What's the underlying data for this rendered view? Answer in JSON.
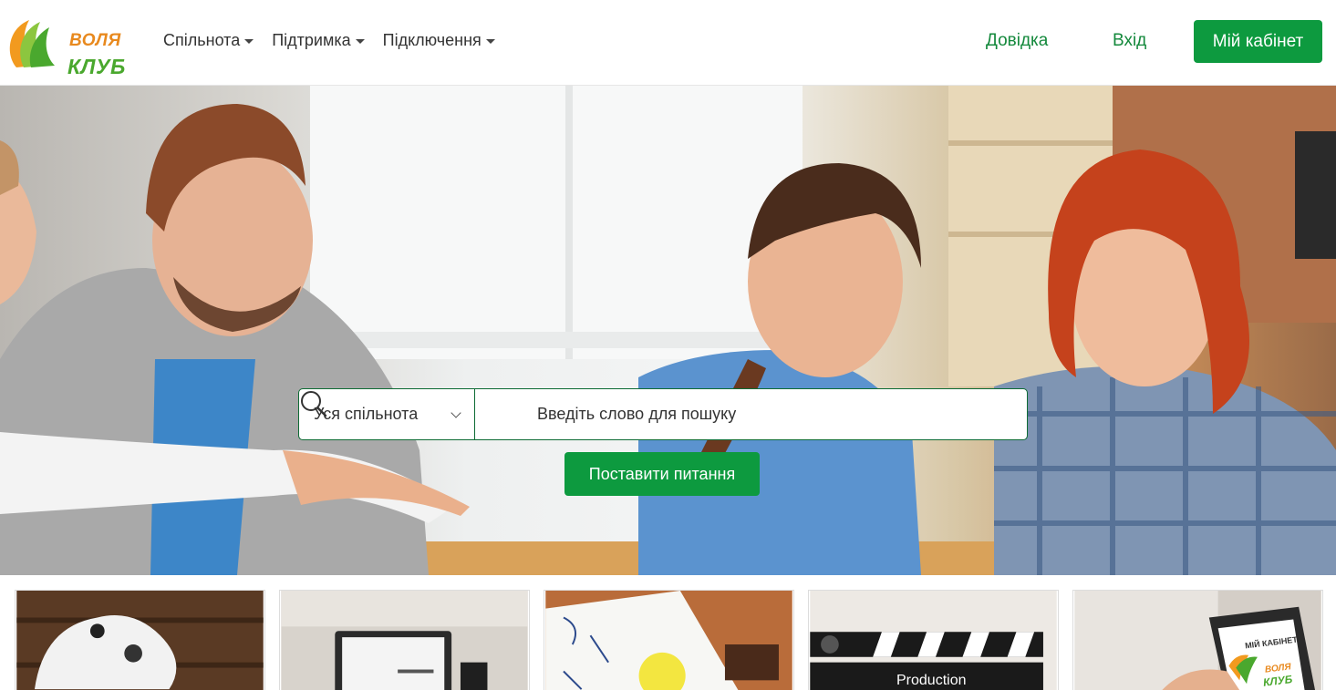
{
  "logo": {
    "line1": "ВОЛЯ",
    "line2": "КЛУБ"
  },
  "nav": {
    "items": [
      {
        "label": "Спільнота"
      },
      {
        "label": "Підтримка"
      },
      {
        "label": "Підключення"
      }
    ]
  },
  "header": {
    "help_label": "Довідка",
    "login_label": "Вхід",
    "cabinet_label": "Мій кабінет"
  },
  "search": {
    "scope_selected": "Уся спільнота",
    "placeholder": "Введіть слово для пошуку"
  },
  "hero": {
    "ask_label": "Поставити питання"
  },
  "cards": [
    {
      "name": "games"
    },
    {
      "name": "laptop"
    },
    {
      "name": "ideas"
    },
    {
      "name": "production",
      "caption": "Production"
    },
    {
      "name": "my-cabinet",
      "caption": "МІЙ КАБІНЕТ",
      "logo_line1": "ВОЛЯ",
      "logo_line2": "КЛУБ"
    }
  ],
  "colors": {
    "brand_green": "#0d9a3f",
    "link_green": "#14893c",
    "logo_orange": "#e8891e"
  }
}
